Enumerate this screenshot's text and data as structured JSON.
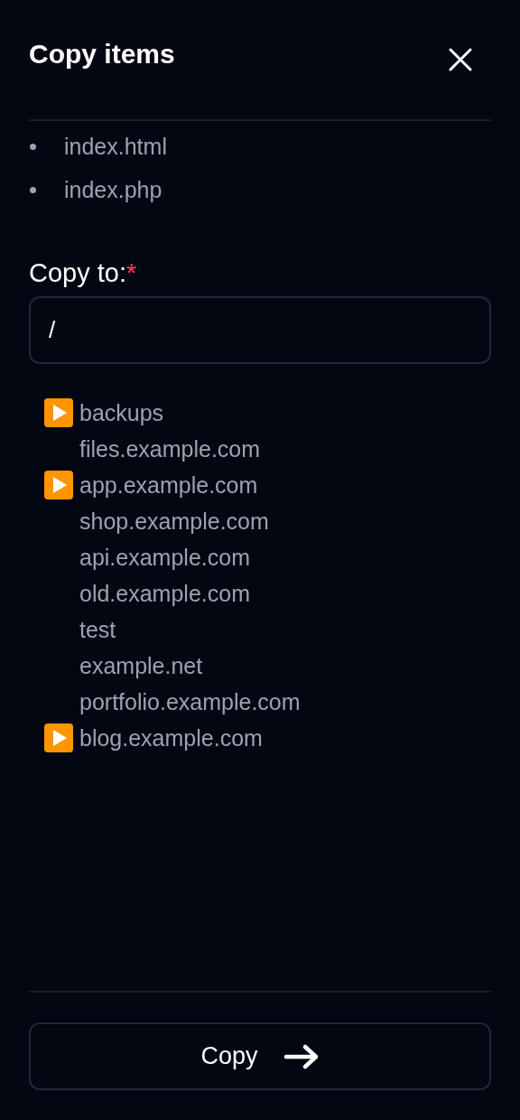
{
  "dialog": {
    "title": "Copy items"
  },
  "items": [
    "index.html",
    "index.php"
  ],
  "destination": {
    "label": "Copy to:",
    "required_mark": "*",
    "value": "/"
  },
  "folders": [
    {
      "name": "backups",
      "expandable": true
    },
    {
      "name": "files.example.com",
      "expandable": false
    },
    {
      "name": "app.example.com",
      "expandable": true
    },
    {
      "name": "shop.example.com",
      "expandable": false
    },
    {
      "name": "api.example.com",
      "expandable": false
    },
    {
      "name": "old.example.com",
      "expandable": false
    },
    {
      "name": "test",
      "expandable": false
    },
    {
      "name": "example.net",
      "expandable": false
    },
    {
      "name": "portfolio.example.com",
      "expandable": false
    },
    {
      "name": "blog.example.com",
      "expandable": true
    }
  ],
  "submit": {
    "label": "Copy"
  }
}
